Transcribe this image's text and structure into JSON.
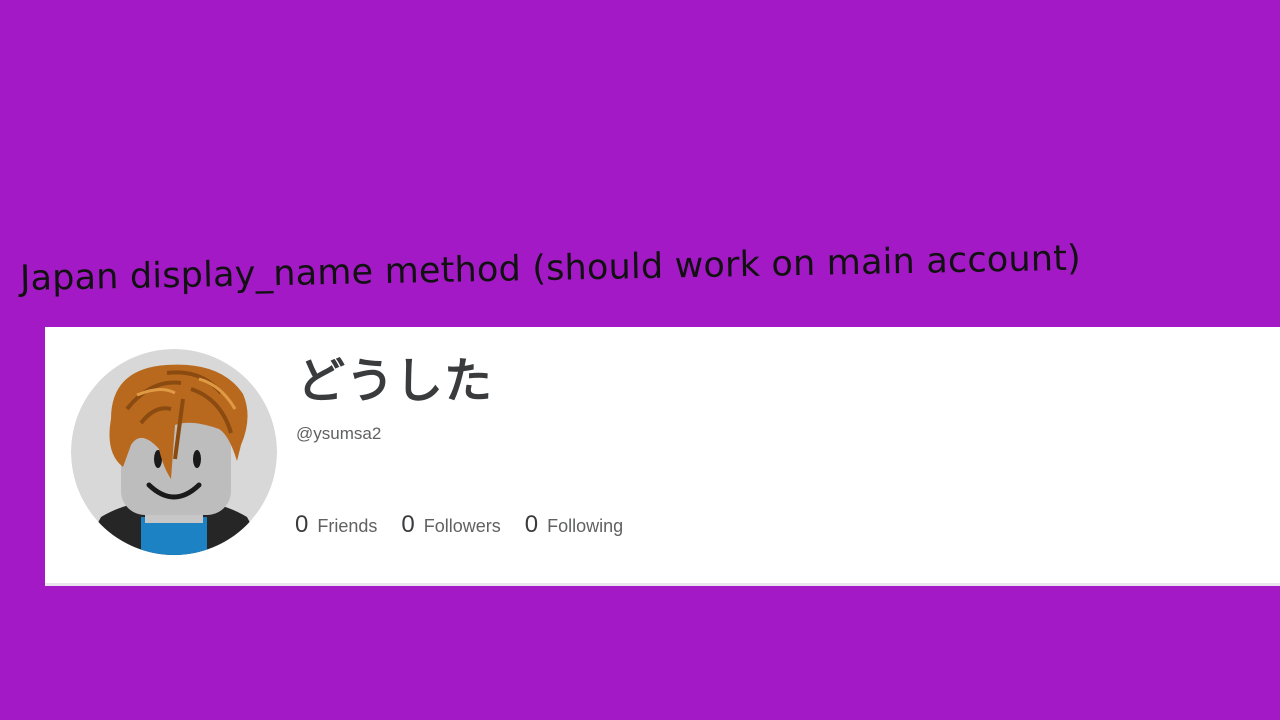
{
  "caption": "Japan display_name method (should work on main account)",
  "colors": {
    "background": "#a319c6",
    "card_background": "#ffffff",
    "text_primary": "#393b3d",
    "text_secondary": "#606162"
  },
  "profile": {
    "avatar_icon": "roblox-avatar-headshot",
    "display_name": "どうした",
    "username": "@ysumsa2",
    "stats": [
      {
        "count": "0",
        "label": "Friends"
      },
      {
        "count": "0",
        "label": "Followers"
      },
      {
        "count": "0",
        "label": "Following"
      }
    ]
  }
}
